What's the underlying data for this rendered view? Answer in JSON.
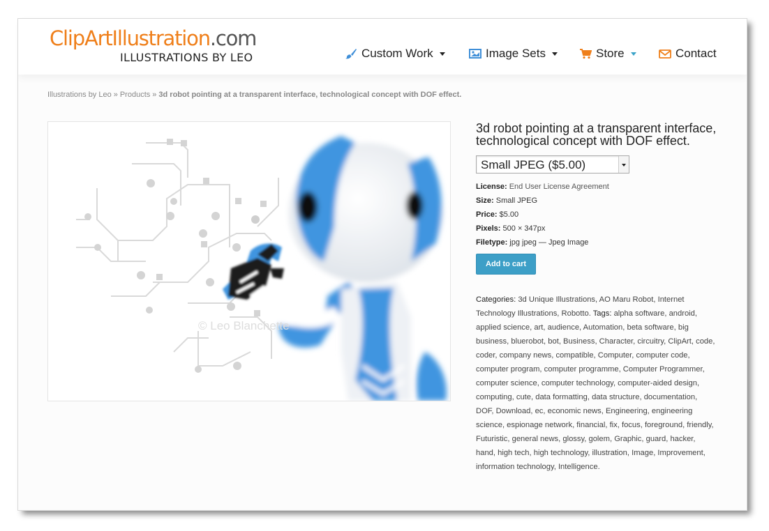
{
  "logo": {
    "main": "ClipArtIllustration",
    "tld": ".com",
    "tagline": "ILLUSTRATIONS BY LEO"
  },
  "nav": [
    {
      "label": "Custom Work",
      "icon": "paintbrush-icon",
      "has_dropdown": true
    },
    {
      "label": "Image Sets",
      "icon": "picture-icon",
      "has_dropdown": true
    },
    {
      "label": "Store",
      "icon": "shopping-cart-icon",
      "has_dropdown": true
    },
    {
      "label": "Contact",
      "icon": "envelope-icon",
      "has_dropdown": false
    }
  ],
  "breadcrumb": {
    "items": [
      "Illustrations by Leo",
      "Products"
    ],
    "separator": "»",
    "current": "3d robot pointing at a transparent interface, technological concept with DOF effect."
  },
  "product": {
    "title": "3d robot pointing at a transparent interface, technological concept with DOF effect.",
    "variation_selected": "Small JPEG ($5.00)",
    "image_alt": "3d robot pointing at a transparent interface",
    "watermark": "© Leo Blanchette",
    "meta": [
      {
        "label": "License:",
        "value": "End User License Agreement"
      },
      {
        "label": "Size:",
        "value": "Small JPEG"
      },
      {
        "label": "Price:",
        "value": "$5.00"
      },
      {
        "label": "Pixels:",
        "value": "500 × 347px"
      },
      {
        "label": "Filetype:",
        "value": "jpg jpeg — Jpeg Image"
      }
    ],
    "add_to_cart": "Add to cart",
    "categories_label": "Categories:",
    "categories": [
      "3d Unique Illustrations",
      "AO Maru Robot",
      "Internet Technology Illustrations",
      "Robotto"
    ],
    "tags_label": "Tags:",
    "tags": [
      "alpha software",
      "android",
      "applied science",
      "art",
      "audience",
      "Automation",
      "beta software",
      "big business",
      "bluerobot",
      "bot",
      "Business",
      "Character",
      "circuitry",
      "ClipArt",
      "code",
      "coder",
      "company news",
      "compatible",
      "Computer",
      "computer code",
      "computer program",
      "computer programme",
      "Computer Programmer",
      "computer science",
      "computer technology",
      "computer-aided design",
      "computing",
      "cute",
      "data formatting",
      "data structure",
      "documentation",
      "DOF",
      "Download",
      "ec",
      "economic news",
      "Engineering",
      "engineering science",
      "espionage network",
      "financial",
      "fix",
      "focus",
      "foreground",
      "friendly",
      "Futuristic",
      "general news",
      "glossy",
      "golem",
      "Graphic",
      "guard",
      "hacker",
      "hand",
      "high tech",
      "high technology",
      "illustration",
      "Image",
      "Improvement",
      "information technology",
      "Intelligence"
    ]
  },
  "colors": {
    "brand_orange": "#ef7f1a",
    "accent_blue": "#3d9fc7",
    "robot_blue": "#3f95e0"
  }
}
